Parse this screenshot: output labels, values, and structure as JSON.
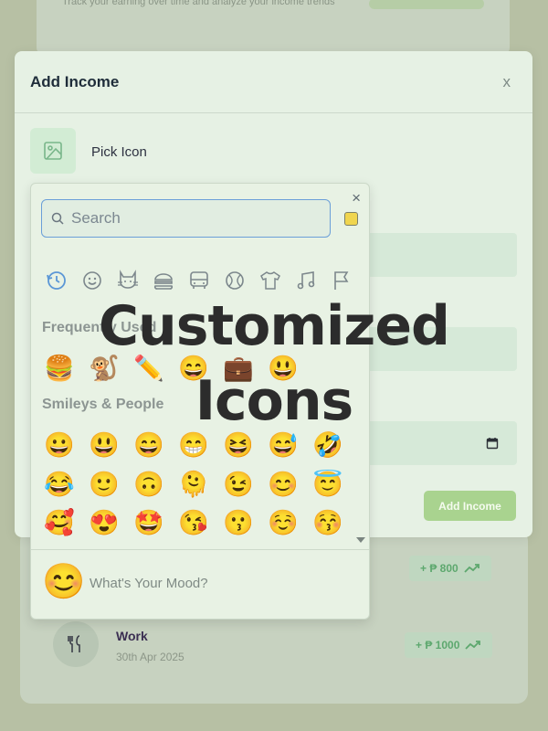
{
  "background": {
    "subtitle": "Track your earning over time and analyze your income trends",
    "entries": [
      {
        "amount": "+ ₱ 800",
        "trend_icon": "trend-up-icon"
      },
      {
        "title": "Work",
        "date": "30th Apr 2025",
        "amount": "+ ₱ 1000",
        "trend_icon": "trend-up-icon",
        "icon": "fork-knife-icon"
      }
    ]
  },
  "modal": {
    "title": "Add Income",
    "close_label": "x",
    "pick_icon_label": "Pick Icon",
    "submit_label": "Add Income"
  },
  "picker": {
    "close_label": "×",
    "search_placeholder": "Search",
    "categories": [
      "recent-icon",
      "smiley-icon",
      "animal-icon",
      "food-icon",
      "travel-icon",
      "activity-icon",
      "objects-icon",
      "symbols-icon",
      "flags-icon"
    ],
    "frequently_used_label": "Frequently Used",
    "frequently_used": [
      "🍔",
      "🐒",
      "✏️",
      "😄",
      "💼",
      "😃"
    ],
    "smileys_label": "Smileys & People",
    "smileys_rows": [
      [
        "😀",
        "😃",
        "😄",
        "😁",
        "😆",
        "😅",
        "🤣"
      ],
      [
        "😂",
        "🙂",
        "🙃",
        "🫠",
        "😉",
        "😊",
        "😇"
      ],
      [
        "🥰",
        "😍",
        "🤩",
        "😘",
        "😗",
        "☺️",
        "😚"
      ]
    ],
    "mood_emoji": "😊",
    "mood_placeholder": "What's Your Mood?"
  },
  "overlay": {
    "line1": "Customized",
    "line2": "Icons"
  },
  "colors": {
    "accent_green": "#a9d38f",
    "income_green": "#5da86e",
    "search_border": "#6b9fd8"
  }
}
